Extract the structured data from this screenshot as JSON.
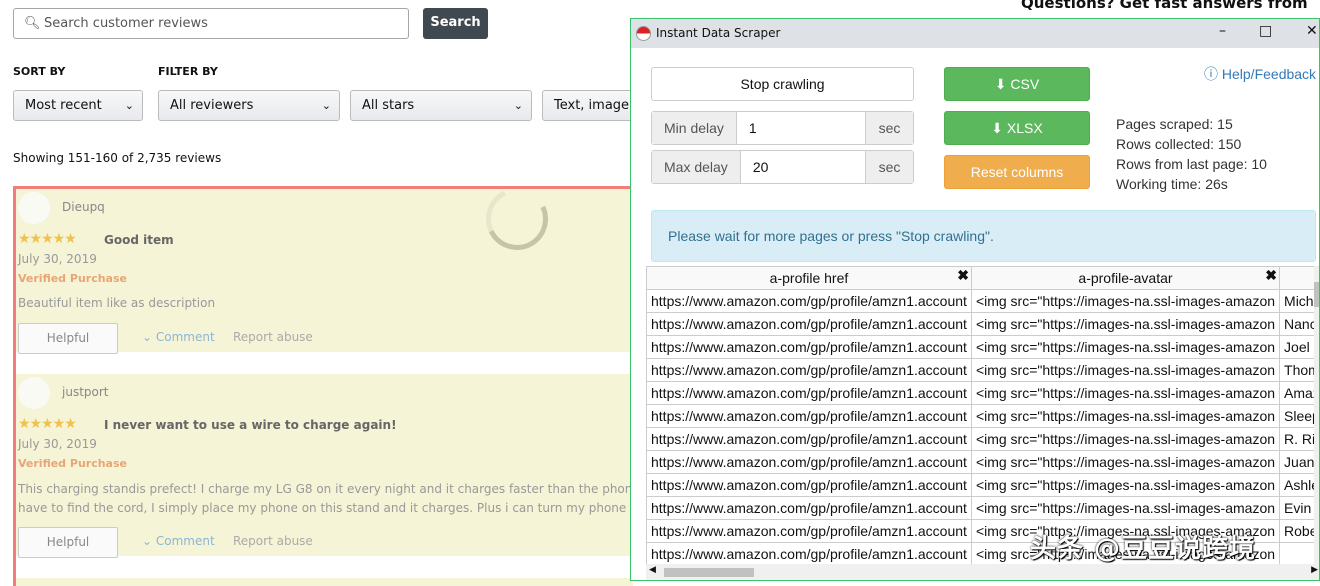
{
  "search": {
    "placeholder": "Search customer reviews",
    "button": "Search"
  },
  "sort_label": "SORT BY",
  "filter_label": "FILTER BY",
  "selects": [
    "Most recent",
    "All reviewers",
    "All stars",
    "Text, image, video"
  ],
  "showing": "Showing 151-160 of 2,735 reviews",
  "questions": "Questions? Get fast answers from reviewers",
  "reviews": [
    {
      "user": "Dieupq",
      "stars": "★★★★★",
      "title": "Good item",
      "date": "July 30, 2019",
      "verified": "Verified Purchase",
      "body": [
        "Beautiful item like as description"
      ],
      "helpful": "Helpful",
      "comment": "Comment",
      "report": "Report abuse"
    },
    {
      "user": "justport",
      "stars": "★★★★★",
      "title": "I never want to use a wire to charge again!",
      "date": "July 30, 2019",
      "verified": "Verified Purchase",
      "body": [
        "This charging standis prefect! I charge my LG G8 on it every night and it charges faster than the phone's c",
        "have to find the cord, I simply place my phone on this stand and it charges. Plus i can turn my phone side"
      ],
      "helpful": "Helpful",
      "comment": "Comment",
      "report": "Report abuse"
    }
  ],
  "scraper": {
    "title": "Instant Data Scraper",
    "stop": "Stop crawling",
    "csv": "CSV",
    "xlsx": "XLSX",
    "reset": "Reset columns",
    "help": "Help/Feedback",
    "min_delay_label": "Min delay",
    "min_delay": "1",
    "max_delay_label": "Max delay",
    "max_delay": "20",
    "unit": "sec",
    "stats": [
      "Pages scraped: 15",
      "Rows collected: 150",
      "Rows from last page: 10",
      "Working time: 26s"
    ],
    "info": "Please wait for more pages or press \"Stop crawling\".",
    "columns": [
      "a-profile href",
      "a-profile-avatar",
      ""
    ],
    "rows": [
      [
        "https://www.amazon.com/gp/profile/amzn1.account",
        "<img src=\"https://images-na.ssl-images-amazon",
        "Michael M"
      ],
      [
        "https://www.amazon.com/gp/profile/amzn1.account",
        "<img src=\"https://images-na.ssl-images-amazon",
        "Nancy Ran"
      ],
      [
        "https://www.amazon.com/gp/profile/amzn1.account",
        "<img src=\"https://images-na.ssl-images-amazon",
        "Joel Plimm"
      ],
      [
        "https://www.amazon.com/gp/profile/amzn1.account",
        "<img src=\"https://images-na.ssl-images-amazon",
        "Thomas W"
      ],
      [
        "https://www.amazon.com/gp/profile/amzn1.account",
        "<img src=\"https://images-na.ssl-images-amazon",
        "Amazon C"
      ],
      [
        "https://www.amazon.com/gp/profile/amzn1.account",
        "<img src=\"https://images-na.ssl-images-amazon",
        "Sleepy.stra"
      ],
      [
        "https://www.amazon.com/gp/profile/amzn1.account",
        "<img src=\"https://images-na.ssl-images-amazon",
        "R. Richard"
      ],
      [
        "https://www.amazon.com/gp/profile/amzn1.account",
        "<img src=\"https://images-na.ssl-images-amazon",
        "Juan Mun"
      ],
      [
        "https://www.amazon.com/gp/profile/amzn1.account",
        "<img src=\"https://images-na.ssl-images-amazon",
        "Ashley Ba"
      ],
      [
        "https://www.amazon.com/gp/profile/amzn1.account",
        "<img src=\"https://images-na.ssl-images-amazon",
        "Evin Deitri"
      ],
      [
        "https://www.amazon.com/gp/profile/amzn1.account",
        "<img src=\"https://images-na.ssl-images-amazon",
        "Robert G."
      ],
      [
        "https://www.amazon.com/gp/profile/amzn1.account",
        "<img src=\"https://images-na.ssl-images-amazon",
        ""
      ]
    ]
  },
  "watermark": "头条 @豆豆说跨境"
}
